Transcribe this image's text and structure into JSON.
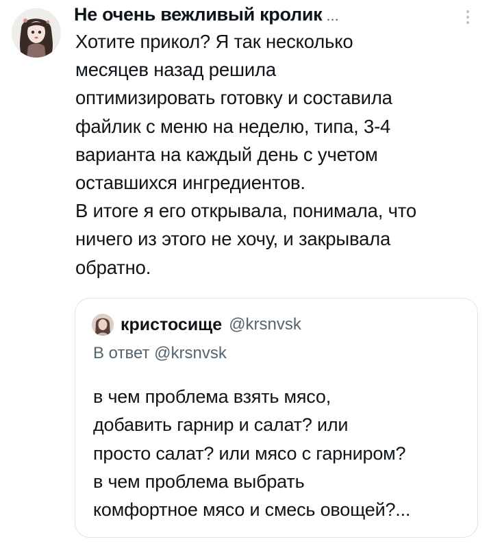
{
  "tweet": {
    "author": {
      "name": "Не очень вежливый кролик",
      "ellipsis": "..."
    },
    "menu_icon": "more-vertical-icon",
    "text": {
      "paragraph1": "Хотите прикол? Я так несколько\nмесяцев назад решила\nоптимизировать готовку и составила\nфайлик с меню на неделю, типа, 3-4\nварианта на каждый день с учетом\nоставшихся ингредиентов.",
      "paragraph2": "В итоге я его открывала, понимала, что\nничего из этого не хочу, и закрывала\nобратно."
    }
  },
  "quote": {
    "author_name": "кристосище",
    "author_handle": "@krsnvsk",
    "reply_to": "В ответ @krsnvsk",
    "text": "в чем проблема взять мясо,\nдобавить гарнир и салат? или\nпросто салат? или мясо с гарниром?\nв чем проблема выбрать\nкомфортное мясо и смесь овощей?..."
  },
  "colors": {
    "text_primary": "#0f1419",
    "text_secondary": "#536471",
    "border": "#dde2e6"
  }
}
